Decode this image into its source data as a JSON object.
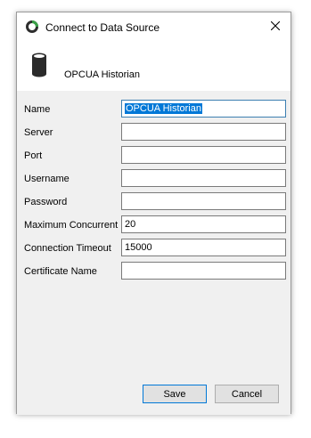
{
  "window": {
    "title": "Connect to Data Source",
    "close_icon": "close-icon",
    "app_icon": "app-ring-icon",
    "accent_color": "#0078d7"
  },
  "header": {
    "source_icon": "database-icon",
    "source_label": "OPCUA Historian"
  },
  "form": {
    "name": {
      "label": "Name",
      "value": "OPCUA Historian"
    },
    "server": {
      "label": "Server",
      "value": ""
    },
    "port": {
      "label": "Port",
      "value": ""
    },
    "username": {
      "label": "Username",
      "value": ""
    },
    "password": {
      "label": "Password",
      "value": ""
    },
    "maximum_concurrent": {
      "label": "Maximum Concurrent",
      "value": "20"
    },
    "connection_timeout": {
      "label": "Connection Timeout",
      "value": "15000"
    },
    "certificate_name": {
      "label": "Certificate Name",
      "value": ""
    }
  },
  "footer": {
    "save_label": "Save",
    "cancel_label": "Cancel"
  }
}
